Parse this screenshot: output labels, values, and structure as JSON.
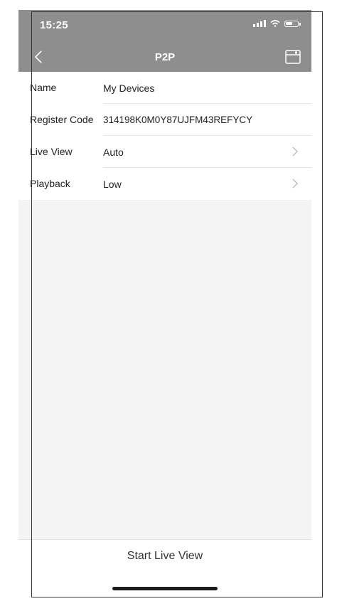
{
  "status_bar": {
    "time": "15:25",
    "icons": [
      "signal-icon",
      "wifi-icon",
      "battery-icon"
    ]
  },
  "nav": {
    "title": "P2P",
    "back_icon": "chevron-left-icon",
    "save_icon": "save-icon"
  },
  "form": {
    "rows": [
      {
        "label": "Name",
        "value": "My Devices"
      },
      {
        "label": "Register Code",
        "value": "314198K0M0Y87UJFM43REFYCY"
      },
      {
        "label": "Live View",
        "value": "Auto"
      },
      {
        "label": "Playback",
        "value": "Low"
      }
    ]
  },
  "footer": {
    "start_label": "Start Live View"
  },
  "colors": {
    "header_bg": "#8e8e8e",
    "content_bg": "#f4f4f4"
  }
}
